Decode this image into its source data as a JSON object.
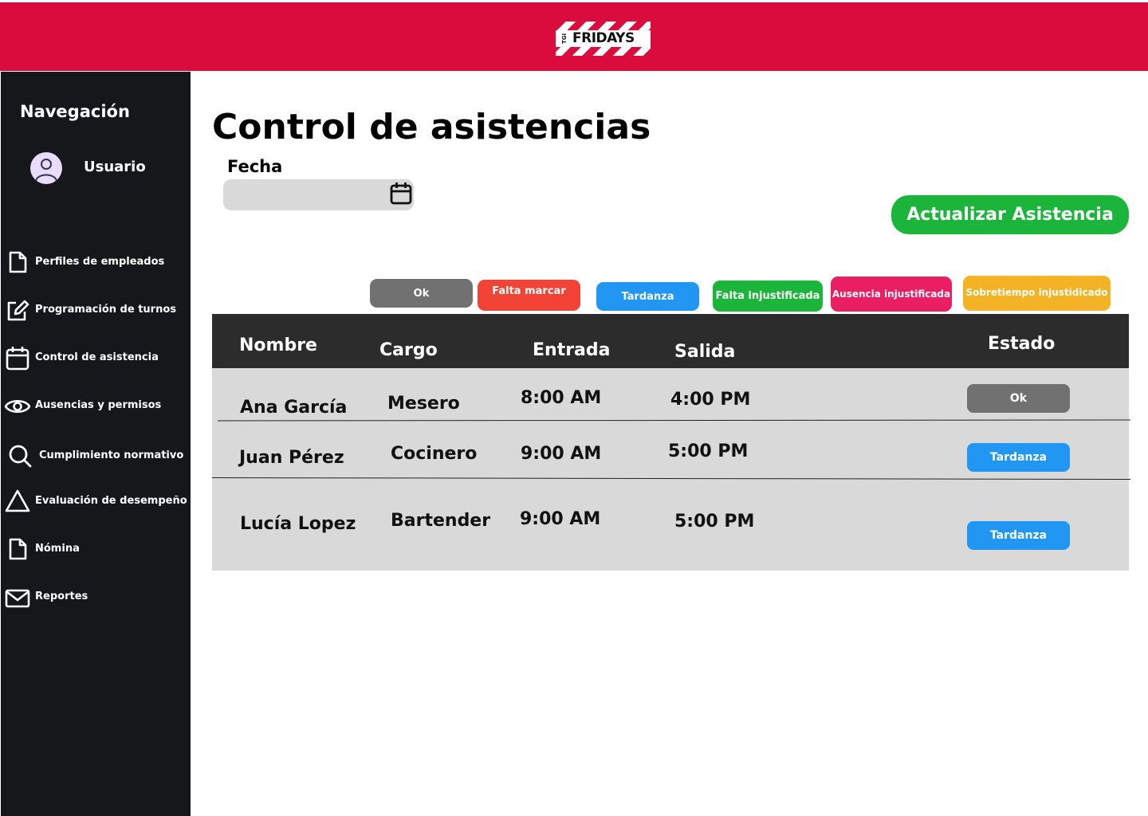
{
  "brand": {
    "logo_text": "FRIDAYS",
    "logo_prefix": "TGI",
    "color": "#d90c3d"
  },
  "sidebar": {
    "title": "Navegación",
    "user": "Usuario",
    "items": [
      {
        "label": "Perfiles de empleados",
        "icon": "document-icon"
      },
      {
        "label": "Programación de turnos",
        "icon": "edit-icon"
      },
      {
        "label": "Control de asistencia",
        "icon": "calendar-icon"
      },
      {
        "label": "Ausencias y permisos",
        "icon": "eye-icon"
      },
      {
        "label": "Cumplimiento normativo",
        "icon": "search-icon"
      },
      {
        "label": "Evaluación de desempeño",
        "icon": "triangle-icon"
      },
      {
        "label": "Nómina",
        "icon": "document-icon"
      },
      {
        "label": "Reportes",
        "icon": "mail-icon"
      }
    ]
  },
  "main": {
    "title": "Control de asistencias",
    "date_label": "Fecha",
    "date_value": "",
    "update_button": "Actualizar Asistencia",
    "legend": [
      {
        "label": "Ok",
        "color": "#717171"
      },
      {
        "label": "Falta marcar",
        "color": "#f24436"
      },
      {
        "label": "Tardanza",
        "color": "#2196f3"
      },
      {
        "label": "Falta injustificada",
        "color": "#1ab53a"
      },
      {
        "label": "Ausencia injustificada",
        "color": "#e91e63"
      },
      {
        "label": "Sobretiempo injustidicado",
        "color": "#f3b324"
      }
    ],
    "table": {
      "headers": [
        "Nombre",
        "Cargo",
        "Entrada",
        "Salida",
        "Estado"
      ],
      "rows": [
        {
          "nombre": "Ana García",
          "cargo": "Mesero",
          "entrada": "8:00 AM",
          "salida": "4:00 PM",
          "estado": "Ok"
        },
        {
          "nombre": "Juan Pérez",
          "cargo": "Cocinero",
          "entrada": "9:00 AM",
          "salida": "5:00 PM",
          "estado": "Tardanza"
        },
        {
          "nombre": "Lucía Lopez",
          "cargo": "Bartender",
          "entrada": "9:00 AM",
          "salida": "5:00 PM",
          "estado": "Tardanza"
        }
      ]
    }
  }
}
